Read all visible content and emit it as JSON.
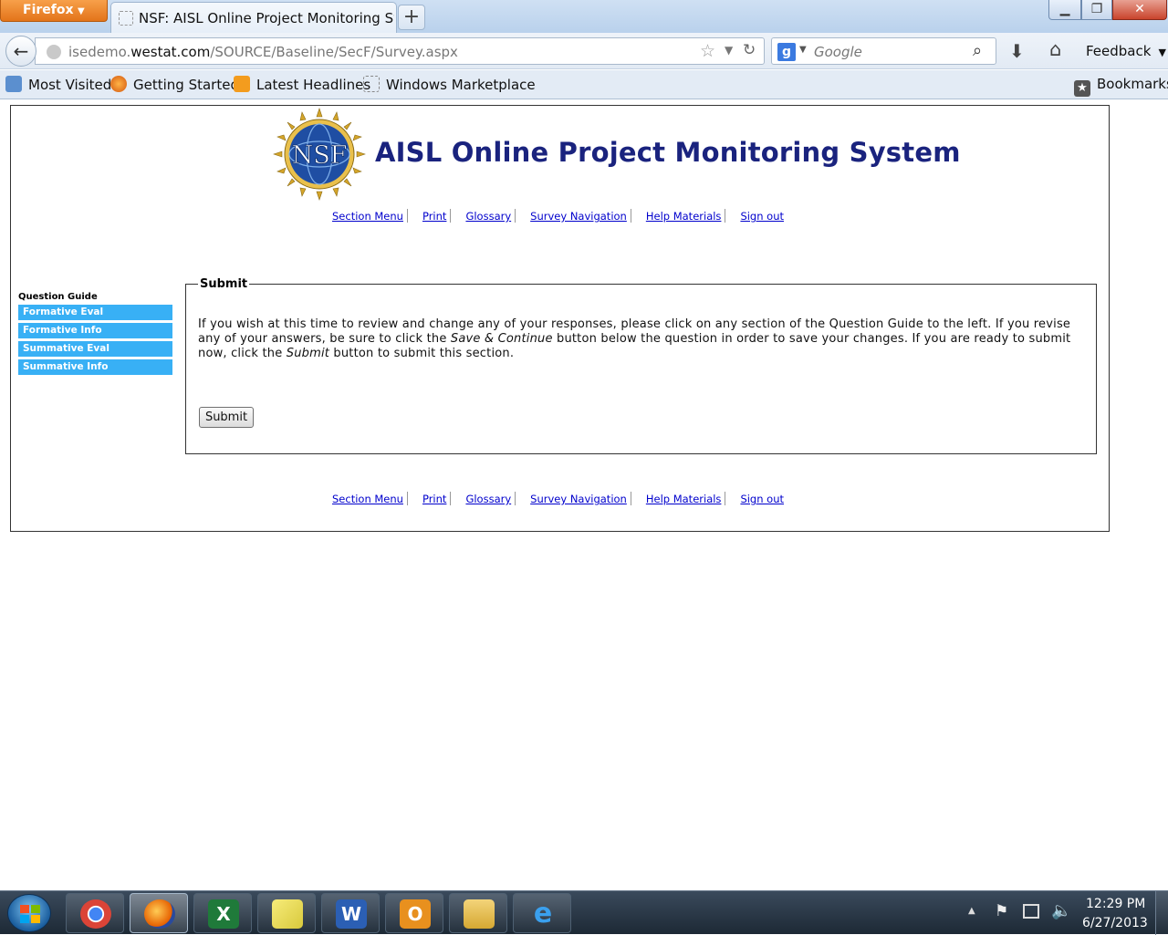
{
  "browser": {
    "menu_button": "Firefox",
    "tab_title": "NSF: AISL Online Project Monitoring Syst...",
    "new_tab_label": "+",
    "url_prefix": "isedemo.",
    "url_domain": "westat.com",
    "url_path": "/SOURCE/Baseline/SecF/Survey.aspx",
    "search_engine": "Google",
    "search_placeholder": "Google",
    "feedback_label": "Feedback",
    "bookmarks": [
      "Most Visited",
      "Getting Started",
      "Latest Headlines",
      "Windows Marketplace"
    ],
    "bookmarks_menu": "Bookmarks"
  },
  "page": {
    "logo_text": "NSF",
    "title": "AISL Online Project Monitoring System",
    "nav_top": [
      "Section Menu",
      "Print",
      "Glossary",
      "Survey Navigation",
      "Help Materials",
      "Sign out"
    ],
    "nav_bottom": [
      "Section Menu",
      "Print",
      "Glossary",
      "Survey Navigation",
      "Help Materials",
      "Sign out"
    ],
    "question_guide": {
      "title": "Question Guide",
      "items": [
        "Formative Eval",
        "Formative Info",
        "Summative Eval",
        "Summative Info"
      ]
    },
    "submit_section": {
      "legend": "Submit",
      "instructions_1": "If you wish at this time to review and change any of your responses, please click on any section of the Question Guide to the left. If you revise any of your answers, be sure to click the ",
      "instructions_em1": "Save & Continue",
      "instructions_2": " button below the question in order to save your changes. If you are ready to submit now, click the ",
      "instructions_em2": "Submit",
      "instructions_3": " button to submit this section.",
      "button_label": "Submit"
    }
  },
  "taskbar": {
    "apps": [
      "chrome",
      "firefox",
      "excel",
      "sticky-notes",
      "word",
      "outlook",
      "explorer",
      "internet-explorer"
    ],
    "active_app": "firefox",
    "time": "12:29 PM",
    "date": "6/27/2013"
  }
}
